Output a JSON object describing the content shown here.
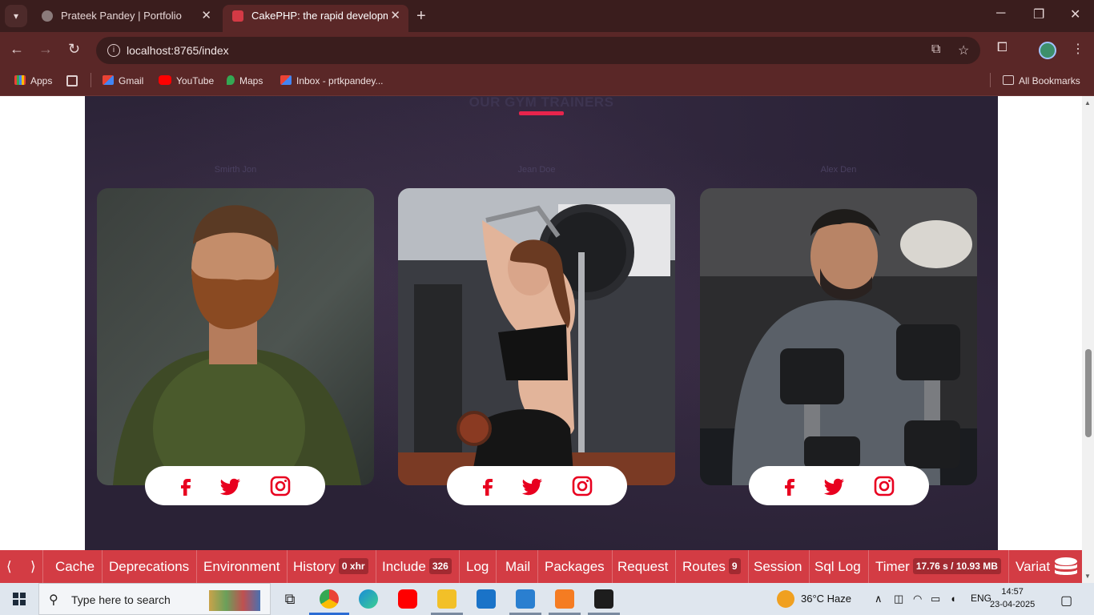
{
  "browser": {
    "tabs": [
      {
        "title": "Prateek Pandey | Portfolio",
        "active": false
      },
      {
        "title": "CakePHP: the rapid development php framework",
        "active": true
      }
    ],
    "url": "localhost:8765/index",
    "bookmarks": [
      {
        "label": "Apps"
      },
      {
        "label": "Gmail"
      },
      {
        "label": "YouTube"
      },
      {
        "label": "Maps"
      },
      {
        "label": "Inbox - prtkpandey..."
      }
    ],
    "all_bookmarks": "All Bookmarks"
  },
  "page": {
    "section_title": "OUR GYM TRAINERS",
    "trainers": [
      {
        "name": "Smirth Jon",
        "image": "bearded-man-green-shirt"
      },
      {
        "name": "Jean Doe",
        "image": "woman-gym-pulldown"
      },
      {
        "name": "Alex Den",
        "image": "man-dumbbells"
      }
    ],
    "social_icons": [
      "facebook-icon",
      "twitter-icon",
      "instagram-icon"
    ],
    "accent_color": "#e8244c",
    "social_icon_color": "#e8001f"
  },
  "debugkit": {
    "prev": "⟨",
    "next": "⟩",
    "items": [
      {
        "label": "Cache",
        "badge": ""
      },
      {
        "label": "Deprecations",
        "badge": ""
      },
      {
        "label": "Environment",
        "badge": ""
      },
      {
        "label": "History",
        "badge": "0 xhr"
      },
      {
        "label": "Include",
        "badge": "326"
      },
      {
        "label": "Log",
        "badge": ""
      },
      {
        "label": "Mail",
        "badge": ""
      },
      {
        "label": "Packages",
        "badge": ""
      },
      {
        "label": "Request",
        "badge": ""
      },
      {
        "label": "Routes",
        "badge": "9"
      },
      {
        "label": "Session",
        "badge": ""
      },
      {
        "label": "Sql Log",
        "badge": ""
      },
      {
        "label": "Timer",
        "badge": "17.76 s / 10.93 MB"
      },
      {
        "label": "Variat",
        "badge": ""
      }
    ],
    "bar_color": "#d33c44"
  },
  "taskbar": {
    "search_placeholder": "Type here to search",
    "weather": "36°C  Haze",
    "language": "ENG",
    "time": "14:57",
    "date": "23-04-2025"
  }
}
